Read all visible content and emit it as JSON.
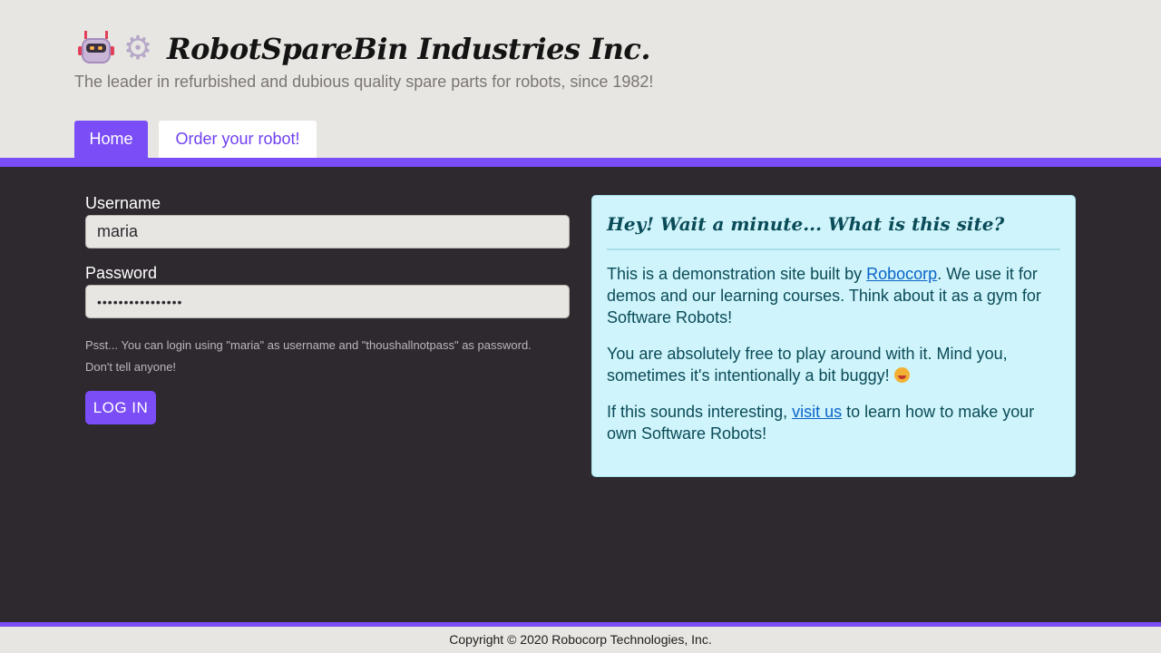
{
  "header": {
    "title": "RobotSpareBin Industries Inc.",
    "tagline": "The leader in refurbished and dubious quality spare parts for robots, since 1982!",
    "logo_icons": [
      "robot-icon",
      "gear-icon"
    ]
  },
  "nav": {
    "tabs": [
      {
        "label": "Home",
        "active": true
      },
      {
        "label": "Order your robot!",
        "active": false
      }
    ]
  },
  "login": {
    "username_label": "Username",
    "username_value": "maria",
    "password_label": "Password",
    "password_masked": "••••••••••••••••",
    "hint_line1": "Psst... You can login using \"maria\" as username and \"thoushallnotpass\" as password.",
    "hint_line2": "Don't tell anyone!",
    "button_label": "LOG IN"
  },
  "info": {
    "title": "Hey! Wait a minute... What is this site?",
    "p1_before": "This is a demonstration site built by ",
    "p1_link": "Robocorp",
    "p1_after": ". We use it for demos and our learning courses. Think about it as a gym for Software Robots!",
    "p2": "You are absolutely free to play around with it. Mind you, sometimes it's intentionally a bit buggy! ",
    "p2_icon": "grinning-face-icon",
    "p3_before": "If this sounds interesting, ",
    "p3_link": "visit us",
    "p3_after": " to learn how to make your own Software Robots!"
  },
  "footer": {
    "copyright": "Copyright © 2020 Robocorp Technologies, Inc."
  },
  "colors": {
    "accent": "#7b4df6",
    "main_bg": "#2e282f",
    "page_bg": "#e8e6e2",
    "info_bg": "#cff4fb",
    "info_text": "#0a4b58",
    "link": "#0b64c9"
  }
}
